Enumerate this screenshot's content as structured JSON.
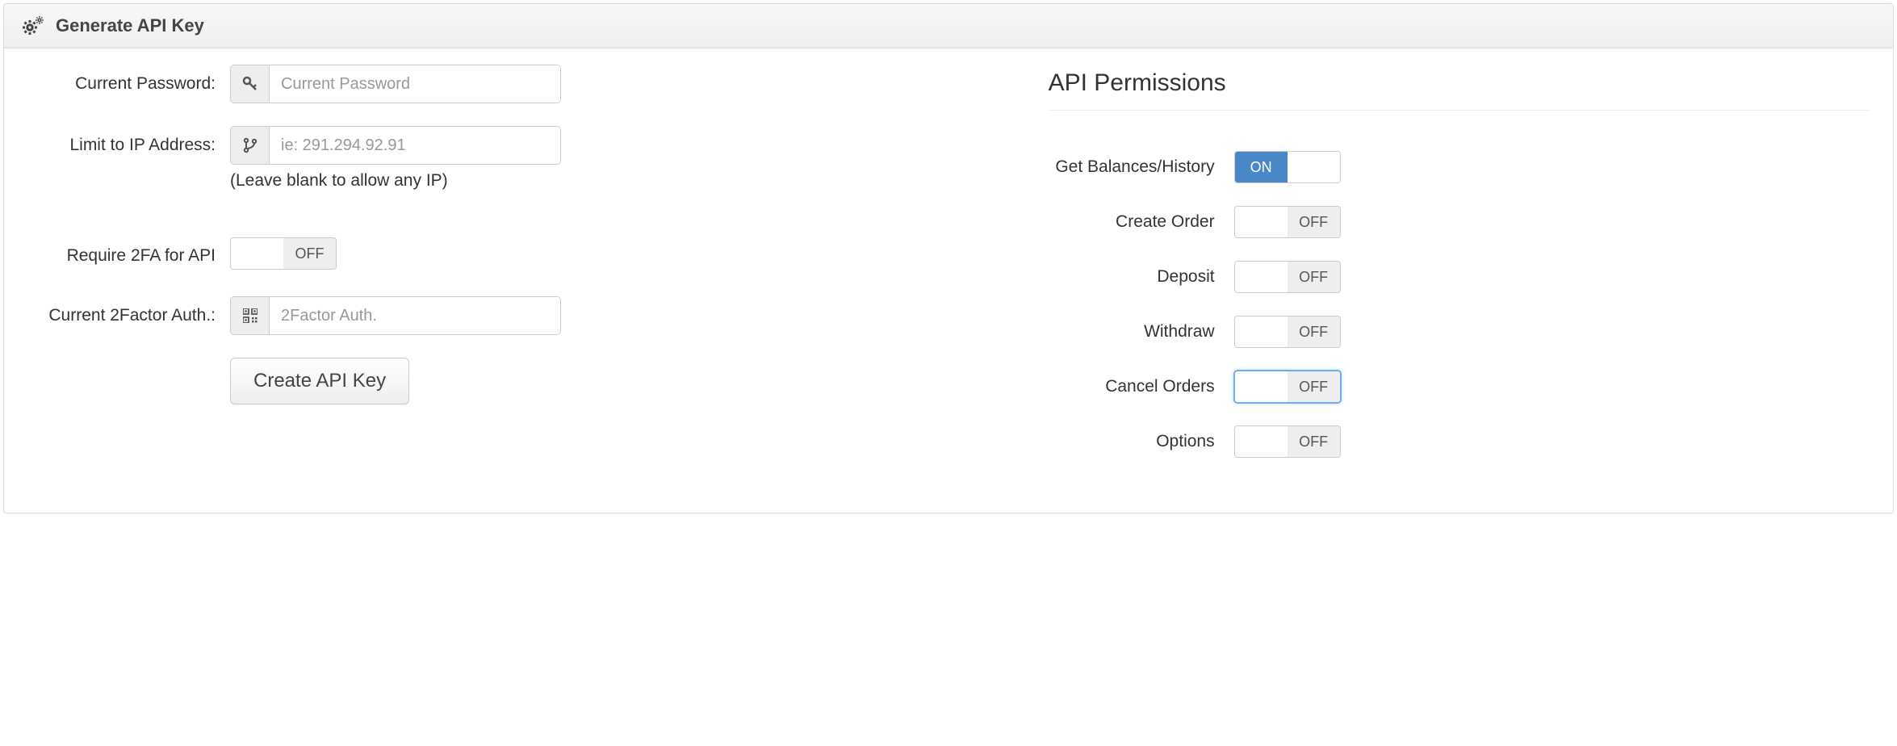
{
  "header": {
    "title": "Generate API Key"
  },
  "form": {
    "password": {
      "label": "Current Password:",
      "placeholder": "Current Password",
      "value": ""
    },
    "ip": {
      "label": "Limit to IP Address:",
      "placeholder": "ie: 291.294.92.91",
      "value": "",
      "hint": "(Leave blank to allow any IP)"
    },
    "require_2fa": {
      "label": "Require 2FA for API",
      "state_label": "OFF",
      "state": false
    },
    "twofactor": {
      "label": "Current 2Factor Auth.:",
      "placeholder": "2Factor Auth.",
      "value": ""
    },
    "submit_label": "Create API Key"
  },
  "permissions": {
    "title": "API Permissions",
    "items": [
      {
        "label": "Get Balances/History",
        "state_label": "ON",
        "state": true,
        "focused": false
      },
      {
        "label": "Create Order",
        "state_label": "OFF",
        "state": false,
        "focused": false
      },
      {
        "label": "Deposit",
        "state_label": "OFF",
        "state": false,
        "focused": false
      },
      {
        "label": "Withdraw",
        "state_label": "OFF",
        "state": false,
        "focused": false
      },
      {
        "label": "Cancel Orders",
        "state_label": "OFF",
        "state": false,
        "focused": true
      },
      {
        "label": "Options",
        "state_label": "OFF",
        "state": false,
        "focused": false
      }
    ]
  }
}
